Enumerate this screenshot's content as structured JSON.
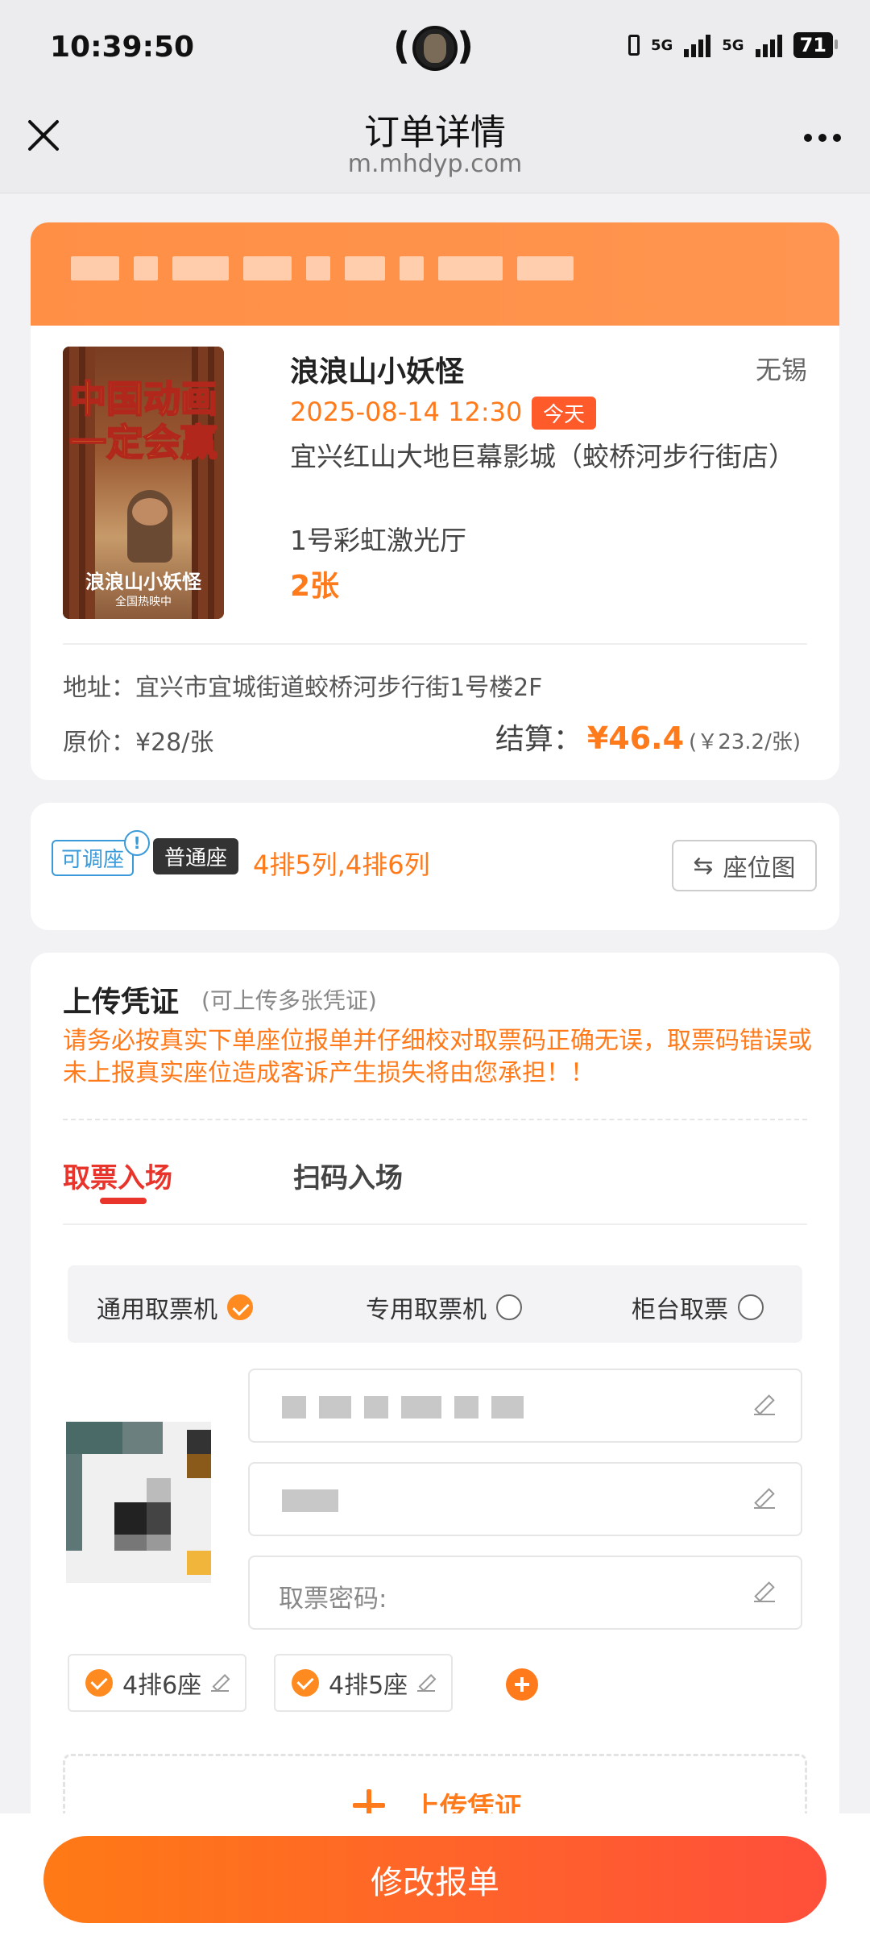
{
  "status_bar": {
    "time": "10:39:50",
    "signal_1": "5G",
    "signal_2": "5G",
    "battery": "71"
  },
  "nav": {
    "title": "订单详情",
    "url": "m.mhdyp.com",
    "close_icon": "close-icon",
    "more_icon": "more-icon"
  },
  "movie": {
    "poster_line_1": "中国动画",
    "poster_line_2": "一定会赢",
    "poster_title": "浪浪山小妖怪",
    "poster_subtitle": "全国热映中",
    "title": "浪浪山小妖怪",
    "city": "无锡",
    "datetime": "2025-08-14 12:30",
    "today_badge": "今天",
    "cinema": "宜兴红山大地巨幕影城（蛟桥河步行街店）",
    "hall": "1号彩虹激光厅",
    "ticket_count": "2张",
    "address": "地址：宜兴市宜城街道蛟桥河步行街1号楼2F",
    "original_price": "原价：¥28/张",
    "settle_label": "结算：",
    "settle_price": "¥46.4",
    "settle_unit": "(￥23.2/张)"
  },
  "seat": {
    "adjustable_badge": "可调座",
    "info_icon_text": "!",
    "normal_badge": "普通座",
    "seats": "4排5列,4排6列",
    "seatmap_button": "座位图",
    "swap_icon": "⇆"
  },
  "upload": {
    "title": "上传凭证",
    "hint": "(可上传多张凭证)",
    "warning": "请务必按真实下单座位报单并仔细校对取票码正确无误，取票码错误或未上报真实座位造成客诉产生损失将由您承担！！",
    "tabs": [
      {
        "label": "取票入场",
        "active": true
      },
      {
        "label": "扫码入场",
        "active": false
      }
    ],
    "machine_options": [
      {
        "label": "通用取票机",
        "selected": true
      },
      {
        "label": "专用取票机",
        "selected": false
      },
      {
        "label": "柜台取票",
        "selected": false
      }
    ],
    "password_label": "取票密码:",
    "seat_chips": [
      "4排6座",
      "4排5座"
    ],
    "upload_label": "上传凭证"
  },
  "footer": {
    "submit_button": "修改报单"
  },
  "colors": {
    "accent": "#ff7a1a",
    "tab_active": "#e9342b",
    "adjustable": "#3a9ad9"
  }
}
